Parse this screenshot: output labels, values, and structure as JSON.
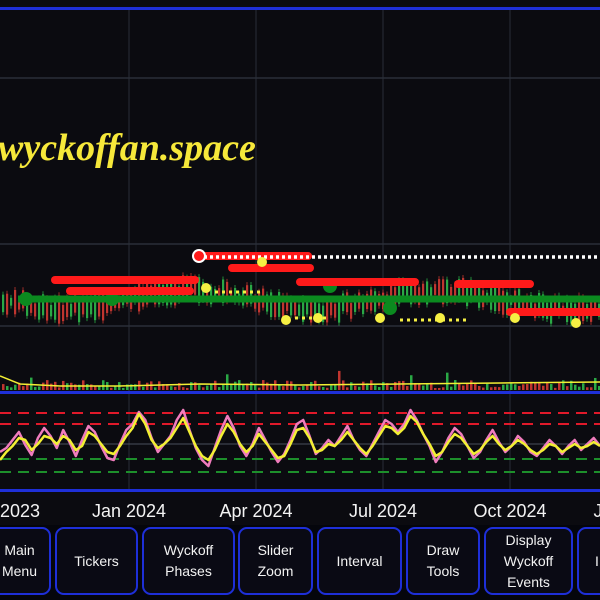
{
  "watermark": "wyckoffan.space",
  "x_axis_ticks": [
    "2023",
    "Jan 2024",
    "Apr 2024",
    "Jul 2024",
    "Oct 2024",
    "J"
  ],
  "colors": {
    "background": "#0b0b10",
    "border": "#1e2fd8",
    "watermark": "#f6e83a",
    "red_line": "#ff1a1a",
    "green_line": "#0b8a1f",
    "white_dots": "#ffffff",
    "yellow_dots": "#f6f043",
    "osc_yellow": "#f2ef33",
    "osc_pink": "#f07cbd",
    "osc_red_dash": "#e0192a",
    "osc_green_dash": "#1d8f2b"
  },
  "toolbar": {
    "buttons": [
      {
        "label": "Main\nMenu"
      },
      {
        "label": "Tickers"
      },
      {
        "label": "Wyckoff\nPhases"
      },
      {
        "label": "Slider\nZoom"
      },
      {
        "label": "Interval"
      },
      {
        "label": "Draw\nTools"
      },
      {
        "label": "Display\nWyckoff\nEvents"
      },
      {
        "label": "I"
      }
    ]
  }
}
